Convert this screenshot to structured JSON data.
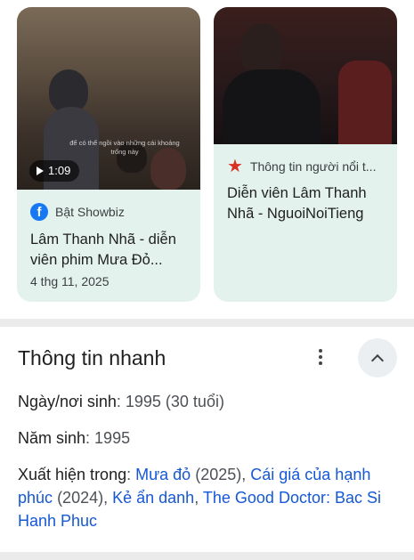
{
  "cards": [
    {
      "thumb_caption": "để có thể ngồi vào những cái khoảng trống này",
      "duration": "1:09",
      "source_icon": "facebook-icon",
      "source": "Bật Showbiz",
      "title": "Lâm Thanh Nhã - diễn viên phim Mưa Đỏ...",
      "date": "4 thg 11, 2025"
    },
    {
      "source_icon": "red-star-icon",
      "source": "Thông tin người nổi t...",
      "title": "Diễn viên Lâm Thanh Nhã - NguoiNoiTieng"
    }
  ],
  "quick_info": {
    "title": "Thông tin nhanh",
    "birth_label": "Ngày/nơi sinh",
    "birth_value": "1995 (30 tuổi)",
    "year_label": "Năm sinh",
    "year_value": "1995",
    "appears_label": "Xuất hiện trong",
    "appears": [
      {
        "name": "Mưa đỏ",
        "year": "(2025)"
      },
      {
        "name": "Cái giá của hạnh phúc",
        "year": "(2024)"
      },
      {
        "name": "Kẻ ẩn danh",
        "year": ""
      },
      {
        "name": "The Good Doctor: Bac Si Hanh Phuc",
        "year": ""
      }
    ]
  },
  "colors": {
    "card_bg": "#e3f2ec",
    "link": "#1558d6",
    "divider": "#ebebeb"
  }
}
